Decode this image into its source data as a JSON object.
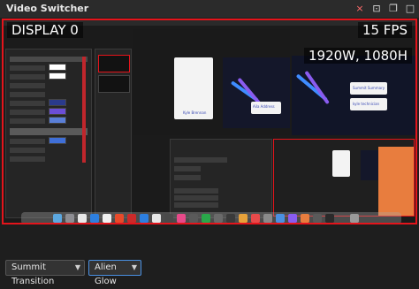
{
  "window": {
    "title": "Video Switcher",
    "controls": {
      "close": "×",
      "pip": "⊡",
      "restore": "❐",
      "maximize": "□"
    }
  },
  "preview": {
    "display_label": "DISPLAY 0",
    "fps_label": "15 FPS",
    "resolution_label": "1920W, 1080H",
    "border_color": "#e4141b",
    "cards": {
      "left_label": "Kyle Brennan",
      "right_top_label": "Summit Summary",
      "right_bottom_label": "kyle technician",
      "mid_label": "Aila Address"
    }
  },
  "bottom_bar": {
    "transition": {
      "label": "Summit Transition",
      "arrow": "▼"
    },
    "effect": {
      "label": "Alien Glow",
      "arrow": "▼"
    }
  },
  "colors": {
    "accent_red": "#e4141b",
    "accent_blue": "#4a90e2",
    "logo_purple": "#8a5cf0",
    "logo_blue": "#3f8cff"
  }
}
